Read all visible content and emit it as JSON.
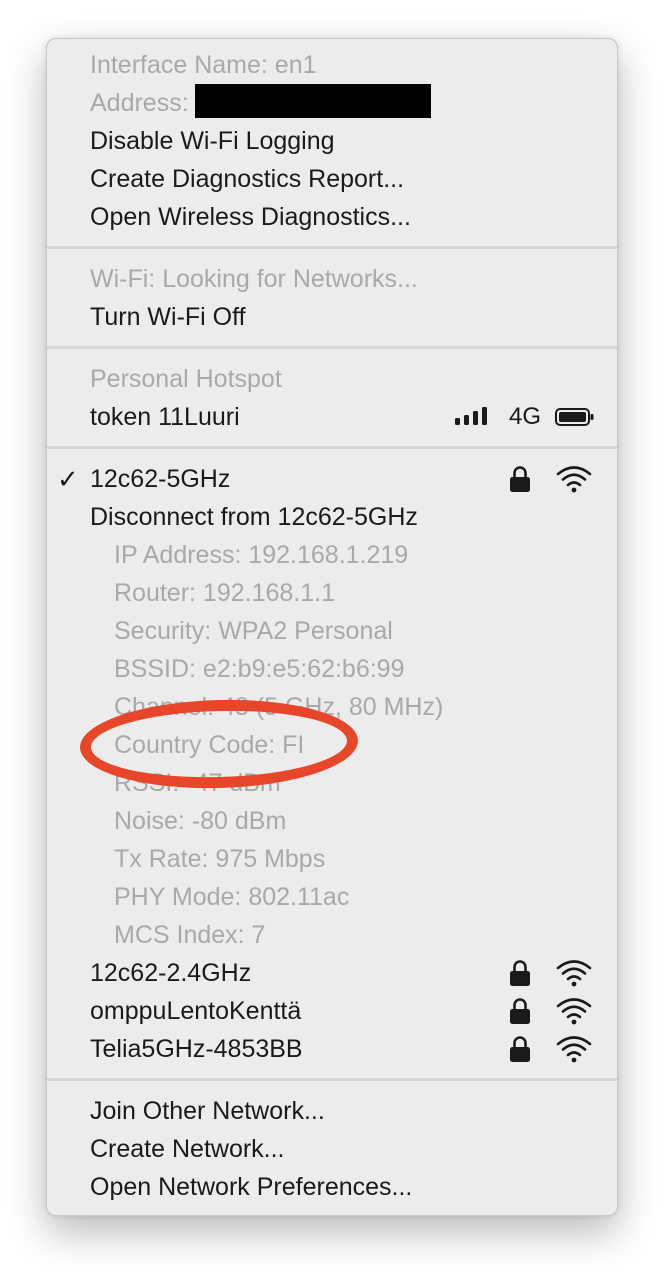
{
  "debug": {
    "interface_name": "Interface Name: en1",
    "address_label": "Address:",
    "disable_logging": "Disable Wi-Fi Logging",
    "create_report": "Create Diagnostics Report...",
    "open_diagnostics": "Open Wireless Diagnostics..."
  },
  "wifi": {
    "status": "Wi-Fi: Looking for Networks...",
    "turn_off": "Turn Wi-Fi Off"
  },
  "hotspot": {
    "header": "Personal Hotspot",
    "device_name": "token 11Luuri",
    "network_type": "4G",
    "signal_icon": "cellular-signal-icon",
    "battery_icon": "battery-icon"
  },
  "current_network": {
    "name": "12c62-5GHz",
    "checkmark": "✓",
    "disconnect": "Disconnect from 12c62-5GHz",
    "details": [
      "IP Address: 192.168.1.219",
      "Router: 192.168.1.1",
      "Security: WPA2 Personal",
      "BSSID: e2:b9:e5:62:b6:99",
      "Channel: 48 (5 GHz, 80 MHz)",
      "Country Code: FI",
      "RSSI: -47 dBm",
      "Noise: -80 dBm",
      "Tx Rate: 975 Mbps",
      "PHY Mode: 802.11ac",
      "MCS Index: 7"
    ]
  },
  "networks": [
    {
      "name": "12c62-2.4GHz"
    },
    {
      "name": "omppuLentoKenttä"
    },
    {
      "name": "Telia5GHz-4853BB"
    }
  ],
  "footer": {
    "join_other": "Join Other Network...",
    "create_network": "Create Network...",
    "open_prefs": "Open Network Preferences..."
  },
  "colors": {
    "annotation": "#e8462a",
    "menu_background": "#ececec",
    "disabled_text": "#a9a9a9"
  }
}
